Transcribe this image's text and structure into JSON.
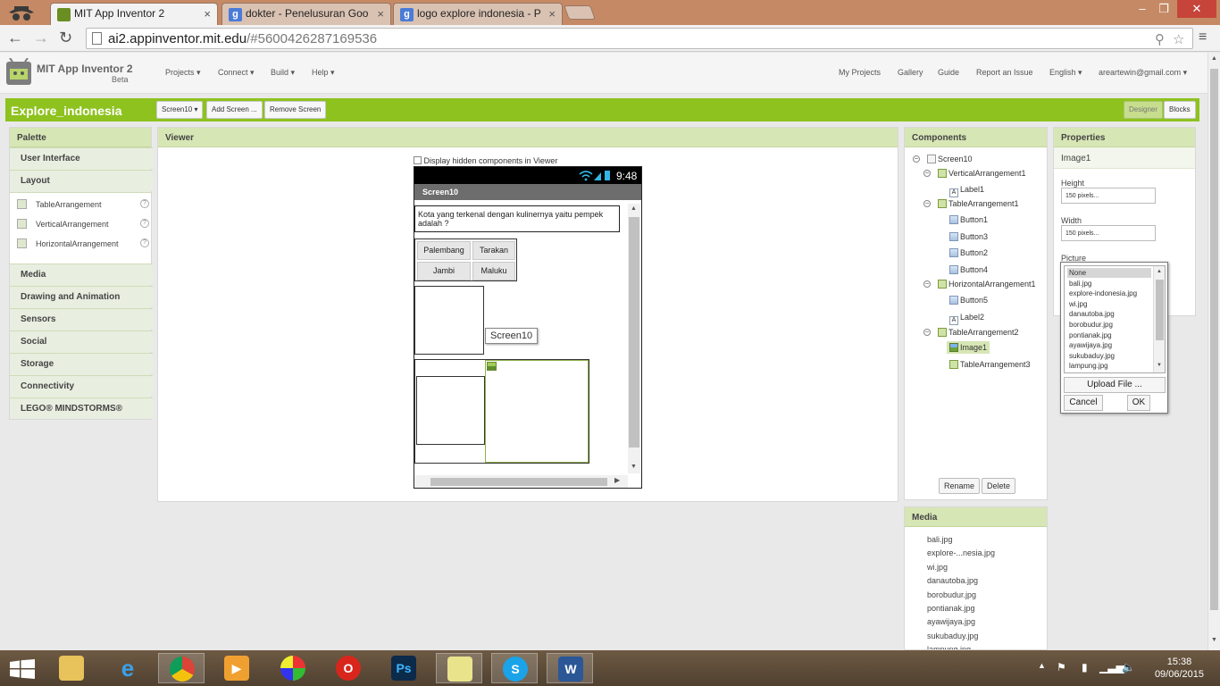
{
  "browser": {
    "tabs": [
      {
        "title": "MIT App Inventor 2",
        "favicon": "app-inventor-icon",
        "active": true
      },
      {
        "title": "dokter - Penelusuran Goo",
        "favicon": "google-icon",
        "active": false
      },
      {
        "title": "logo explore indonesia - P",
        "favicon": "google-icon",
        "active": false
      }
    ],
    "url_host": "ai2.appinventor.mit.edu",
    "url_hash": "/#5600426287169536"
  },
  "app": {
    "title": "MIT App Inventor 2",
    "beta": "Beta",
    "menus": [
      "Projects ▾",
      "Connect ▾",
      "Build ▾",
      "Help ▾"
    ],
    "right_links": [
      "My Projects",
      "Gallery",
      "Guide",
      "Report an Issue",
      "English ▾",
      "areartewin@gmail.com ▾"
    ]
  },
  "project": {
    "name": "Explore_indonesia",
    "screen_select": "Screen10 ▾",
    "add_screen": "Add Screen ...",
    "remove_screen": "Remove Screen",
    "designer": "Designer",
    "blocks": "Blocks"
  },
  "palette": {
    "title": "Palette",
    "categories": [
      "User Interface",
      "Layout",
      "Media",
      "Drawing and Animation",
      "Sensors",
      "Social",
      "Storage",
      "Connectivity",
      "LEGO® MINDSTORMS®"
    ],
    "layout_items": [
      "TableArrangement",
      "VerticalArrangement",
      "HorizontalArrangement"
    ],
    "help": "?"
  },
  "viewer": {
    "title": "Viewer",
    "hidden_label": "Display hidden components in Viewer",
    "clock": "9:48",
    "screen_title": "Screen10",
    "label_text": "Kota yang terkenal dengan kulinernya yaitu pempek adalah ?",
    "buttons": [
      "Palembang",
      "Tarakan",
      "Jambi",
      "Maluku"
    ],
    "tooltip": "Screen10"
  },
  "components": {
    "title": "Components",
    "tree": [
      "Screen10",
      "VerticalArrangement1",
      "Label1",
      "TableArrangement1",
      "Button1",
      "Button3",
      "Button2",
      "Button4",
      "HorizontalArrangement1",
      "Button5",
      "Label2",
      "TableArrangement2",
      "Image1",
      "TableArrangement3"
    ],
    "rename": "Rename",
    "delete": "Delete"
  },
  "properties": {
    "title": "Properties",
    "component": "Image1",
    "height_label": "Height",
    "height_value": "150 pixels...",
    "width_label": "Width",
    "width_value": "150 pixels...",
    "picture_label": "Picture",
    "picture_options": [
      "None",
      "bali.jpg",
      "explore-indonesia.jpg",
      "wi.jpg",
      "danautoba.jpg",
      "borobudur.jpg",
      "pontianak.jpg",
      "ayawijaya.jpg",
      "sukubaduy.jpg",
      "lampung.jpg"
    ],
    "upload": "Upload File ...",
    "cancel": "Cancel",
    "ok": "OK"
  },
  "media": {
    "title": "Media",
    "items": [
      "bali.jpg",
      "explore-...nesia.jpg",
      "wi.jpg",
      "danautoba.jpg",
      "borobudur.jpg",
      "pontianak.jpg",
      "ayawijaya.jpg",
      "sukubaduy.jpg",
      "lampung.jpg"
    ]
  },
  "taskbar": {
    "time": "15:38",
    "date": "09/06/2015",
    "ps_label": "Ps"
  },
  "colors": {
    "project_bar": "#8ec21f",
    "panel_head": "#d7e6b5"
  }
}
